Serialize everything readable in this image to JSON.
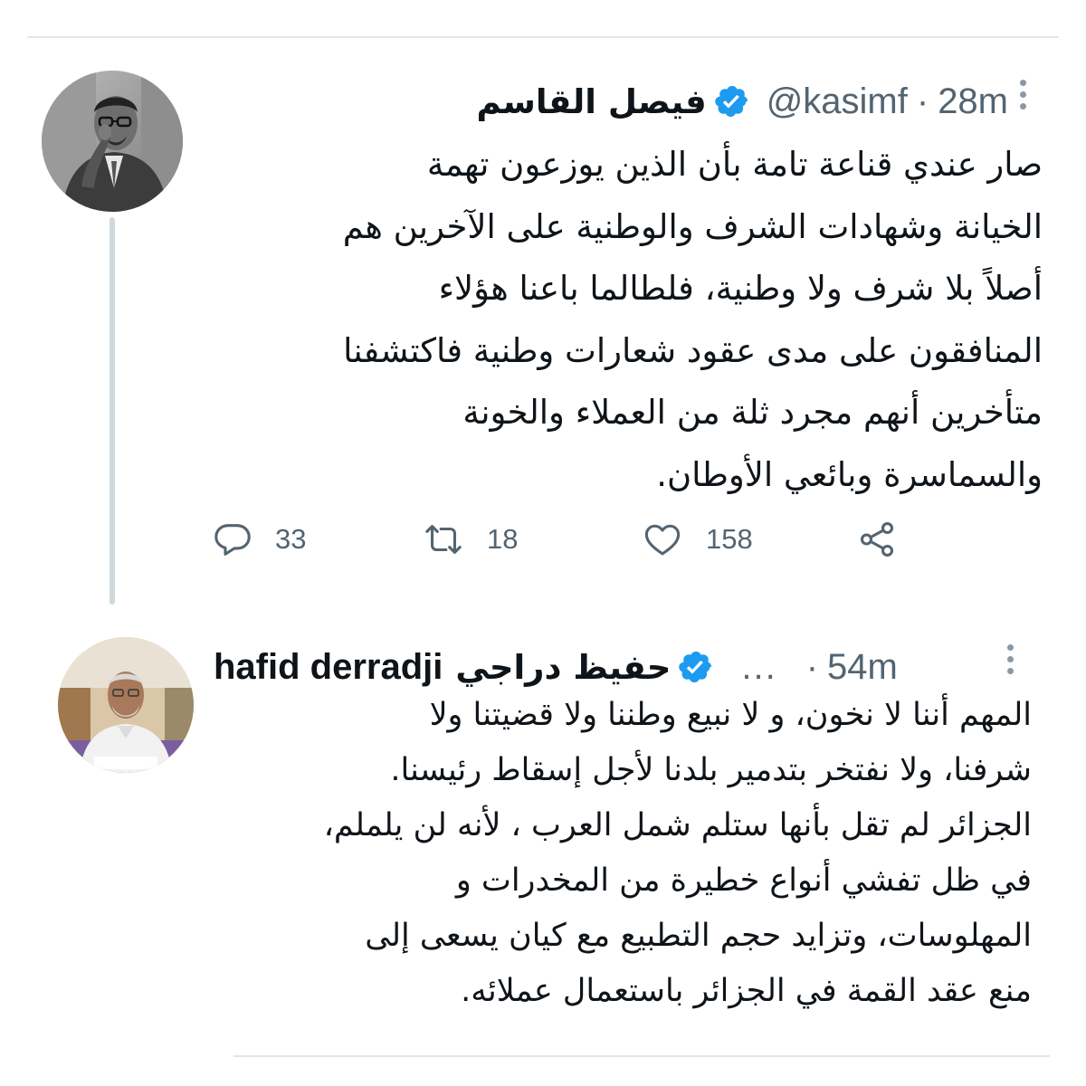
{
  "tweets": [
    {
      "author_name": "فيصل القاسم",
      "handle": "@kasimf",
      "separator": "·",
      "time": "28m",
      "avatar": "avatar-photo",
      "verified_icon": "verified-badge-icon",
      "text_lines": [
        "صار عندي قناعة تامة بأن الذين يوزعون تهمة",
        "الخيانة وشهادات الشرف والوطنية على الآخرين هم",
        "أصلاً بلا شرف ولا وطنية، فلطالما باعنا هؤلاء",
        "المنافقون على مدى عقود شعارات وطنية فاكتشفنا",
        "متأخرين أنهم مجرد ثلة من العملاء والخونة",
        "والسماسرة وبائعي الأوطان."
      ],
      "replies": "33",
      "retweets": "18",
      "likes": "158"
    },
    {
      "author_name_en": "hafid derradji",
      "author_name_ar": "حفيظ دراجي",
      "truncation": "...",
      "separator": "·",
      "time": "54m",
      "avatar": "avatar-photo",
      "verified_icon": "verified-badge-icon",
      "text_lines": [
        "المهم أننا لا نخون، و لا نبيع وطننا ولا قضيتنا ولا",
        "شرفنا، ولا نفتخر بتدمير بلدنا لأجل إسقاط رئيسنا.",
        "الجزائر لم تقل بأنها ستلم شمل العرب ، لأنه لن يلملم،",
        "في ظل تفشي أنواع خطيرة من المخدرات و",
        "المهلوسات، وتزايد حجم التطبيع مع كيان يسعى إلى",
        "منع عقد القمة في الجزائر باستعمال عملائه."
      ]
    }
  ],
  "colors": {
    "verified_blue": "#1d9bf0",
    "text": "#0f1419",
    "secondary_text": "#536471",
    "thread_line": "#cfd9de"
  },
  "icons": [
    "reply-icon",
    "retweet-icon",
    "like-icon",
    "share-icon",
    "more-options-icon"
  ]
}
